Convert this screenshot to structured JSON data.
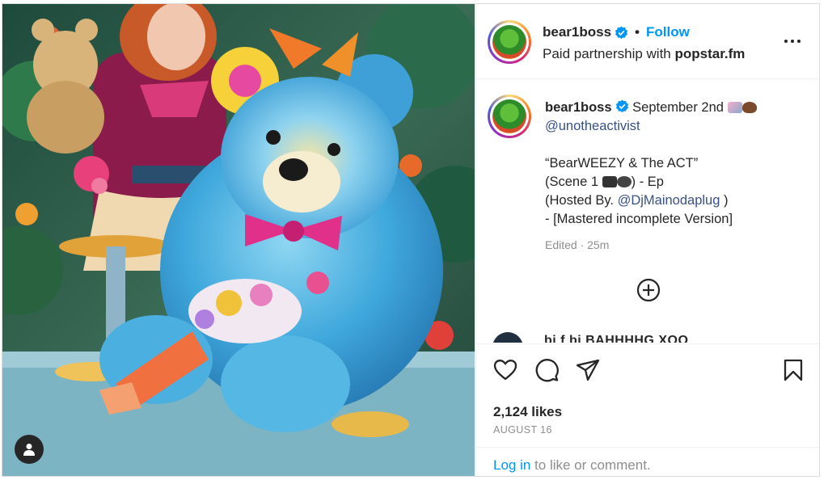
{
  "post": {
    "username": "bear1boss",
    "follow_label": "Follow",
    "separator": "•",
    "partnership_prefix": "Paid partnership with",
    "partner": "popstar.fm"
  },
  "caption": {
    "username": "bear1boss",
    "date_text": "September 2nd",
    "mention_line": "@unotheactivist",
    "title_line": "“BearWEEZY & The ACT”",
    "scene_prefix": "(Scene 1",
    "scene_suffix": ") - Ep",
    "hosted_prefix": "(Hosted By.",
    "hosted_mention": "@DjMainodaplug",
    "hosted_suffix": ")",
    "mastered_line": "- [Mastered incomplete Version]",
    "edited_meta": "Edited · 25m"
  },
  "next_comment_preview": "bi f     bi          BAHHHHG XOO",
  "engagement": {
    "likes": "2,124 likes",
    "date": "AUGUST 16"
  },
  "footer": {
    "login_label": "Log in",
    "suffix": " to like or comment."
  },
  "icons": {
    "verified": "verified-badge-icon",
    "more": "more-options-icon",
    "add_comments": "plus-circle-icon",
    "like": "heart-icon",
    "comment": "comment-bubble-icon",
    "share": "paper-plane-icon",
    "save": "bookmark-icon",
    "user_tag": "person-icon"
  },
  "colors": {
    "link_blue": "#0095f6",
    "mention_blue": "#385185",
    "muted_text": "#8e8e8e",
    "verified_blue": "#0095f6"
  }
}
